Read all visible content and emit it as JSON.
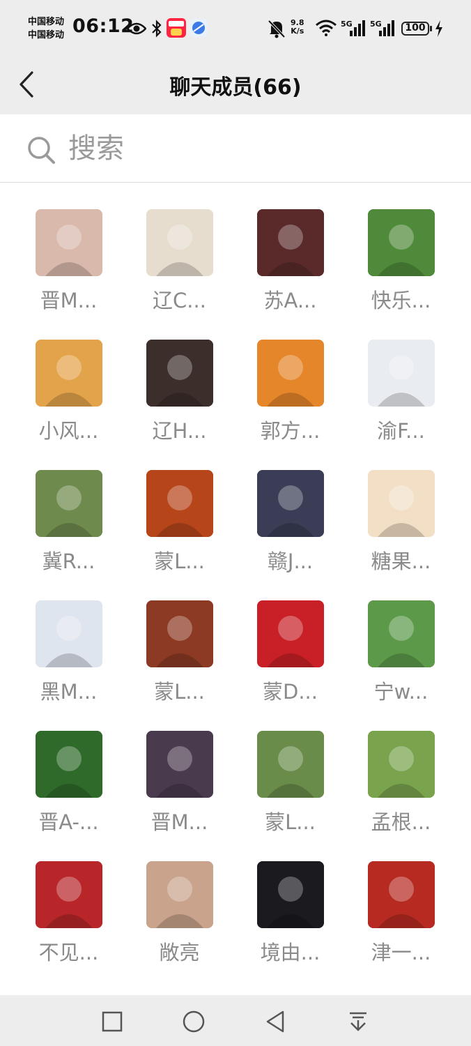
{
  "status_bar": {
    "carrier_1": "中国移动",
    "carrier_2": "中国移动",
    "time": "06:12",
    "speed_value": "9.8",
    "speed_unit": "K/s",
    "sim1_label": "5G",
    "sim2_label": "5G",
    "battery": "100",
    "app_badge": "小红书"
  },
  "header": {
    "title": "聊天成员(66)",
    "back_icon": "chevron-left-icon"
  },
  "search": {
    "placeholder": "搜索",
    "icon": "search-icon"
  },
  "members": [
    {
      "name": "晋M...",
      "avatar_color": "#d9b9ac"
    },
    {
      "name": "辽C...",
      "avatar_color": "#e7ddcf"
    },
    {
      "name": "苏A...",
      "avatar_color": "#5a2a2a"
    },
    {
      "name": "快乐...",
      "avatar_color": "#4f8a3a"
    },
    {
      "name": "小风...",
      "avatar_color": "#e3a34a"
    },
    {
      "name": "辽H...",
      "avatar_color": "#3b2e2b"
    },
    {
      "name": "郭方...",
      "avatar_color": "#e6862a"
    },
    {
      "name": "渝F...",
      "avatar_color": "#e9ecf0"
    },
    {
      "name": "冀R...",
      "avatar_color": "#6f8a4d"
    },
    {
      "name": "蒙L...",
      "avatar_color": "#b6451a"
    },
    {
      "name": "赣J...",
      "avatar_color": "#3a3d55"
    },
    {
      "name": "糖果...",
      "avatar_color": "#f3dfc6"
    },
    {
      "name": "黑M...",
      "avatar_color": "#dfe5ee"
    },
    {
      "name": "蒙L...",
      "avatar_color": "#8d3a24"
    },
    {
      "name": "蒙D...",
      "avatar_color": "#c82026"
    },
    {
      "name": "宁w...",
      "avatar_color": "#5c9a4a"
    },
    {
      "name": "晋A-...",
      "avatar_color": "#2f6a2a"
    },
    {
      "name": "晋M...",
      "avatar_color": "#4a3a4e"
    },
    {
      "name": "蒙L...",
      "avatar_color": "#6a8c4a"
    },
    {
      "name": "孟根...",
      "avatar_color": "#7aa34e"
    },
    {
      "name": "不见...",
      "avatar_color": "#b8262a"
    },
    {
      "name": "敞亮",
      "avatar_color": "#c9a38c"
    },
    {
      "name": "境由...",
      "avatar_color": "#1a1a1f"
    },
    {
      "name": "津一...",
      "avatar_color": "#b62a22"
    }
  ],
  "nav": {
    "recents_icon": "square-icon",
    "home_icon": "circle-icon",
    "back_icon": "triangle-back-icon",
    "menu_icon": "pull-down-icon"
  }
}
